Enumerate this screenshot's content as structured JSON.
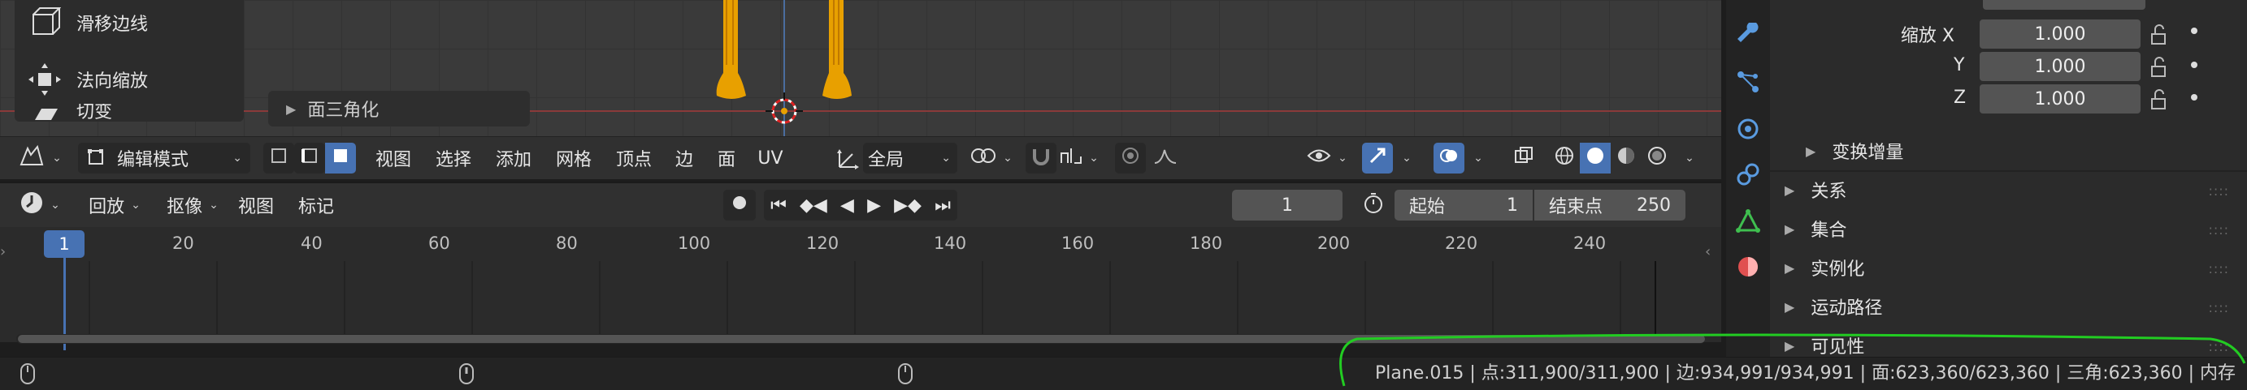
{
  "tools": [
    {
      "label": "滑移边线",
      "icon": "edge-slide-icon"
    },
    {
      "label": "法向缩放",
      "icon": "shrink-fatten-icon"
    },
    {
      "label": "切变",
      "icon": "shear-icon"
    }
  ],
  "redo_panel": {
    "label": "面三角化"
  },
  "viewport_header": {
    "mode": "编辑模式",
    "menus": [
      "视图",
      "选择",
      "添加",
      "网格",
      "顶点",
      "边",
      "面",
      "UV"
    ],
    "orientation": "全局"
  },
  "timeline_header": {
    "playback": "回放",
    "keying": "抠像",
    "view": "视图",
    "marker": "标记",
    "current_frame": "1",
    "start_label": "起始",
    "start_value": "1",
    "end_label": "结束点",
    "end_value": "250"
  },
  "timeline": {
    "current_frame_marker": "1",
    "ticks": [
      "20",
      "40",
      "60",
      "80",
      "100",
      "120",
      "140",
      "160",
      "180",
      "200",
      "220",
      "240"
    ]
  },
  "properties": {
    "scale_label": "缩放 X",
    "y_label": "Y",
    "z_label": "Z",
    "scale_x": "1.000",
    "scale_y": "1.000",
    "scale_z": "1.000",
    "delta": "变换增量",
    "sections": [
      "关系",
      "集合",
      "实例化",
      "运动路径",
      "可见性"
    ]
  },
  "statusbar": {
    "text": "Plane.015 | 点:311,900/311,900 | 边:934,991/934,991 | 面:623,360/623,360 | 三角:623,360  | 内存"
  },
  "colors": {
    "accent": "#4772b3",
    "annotation": "#22cc22",
    "object": "#e8a000"
  }
}
